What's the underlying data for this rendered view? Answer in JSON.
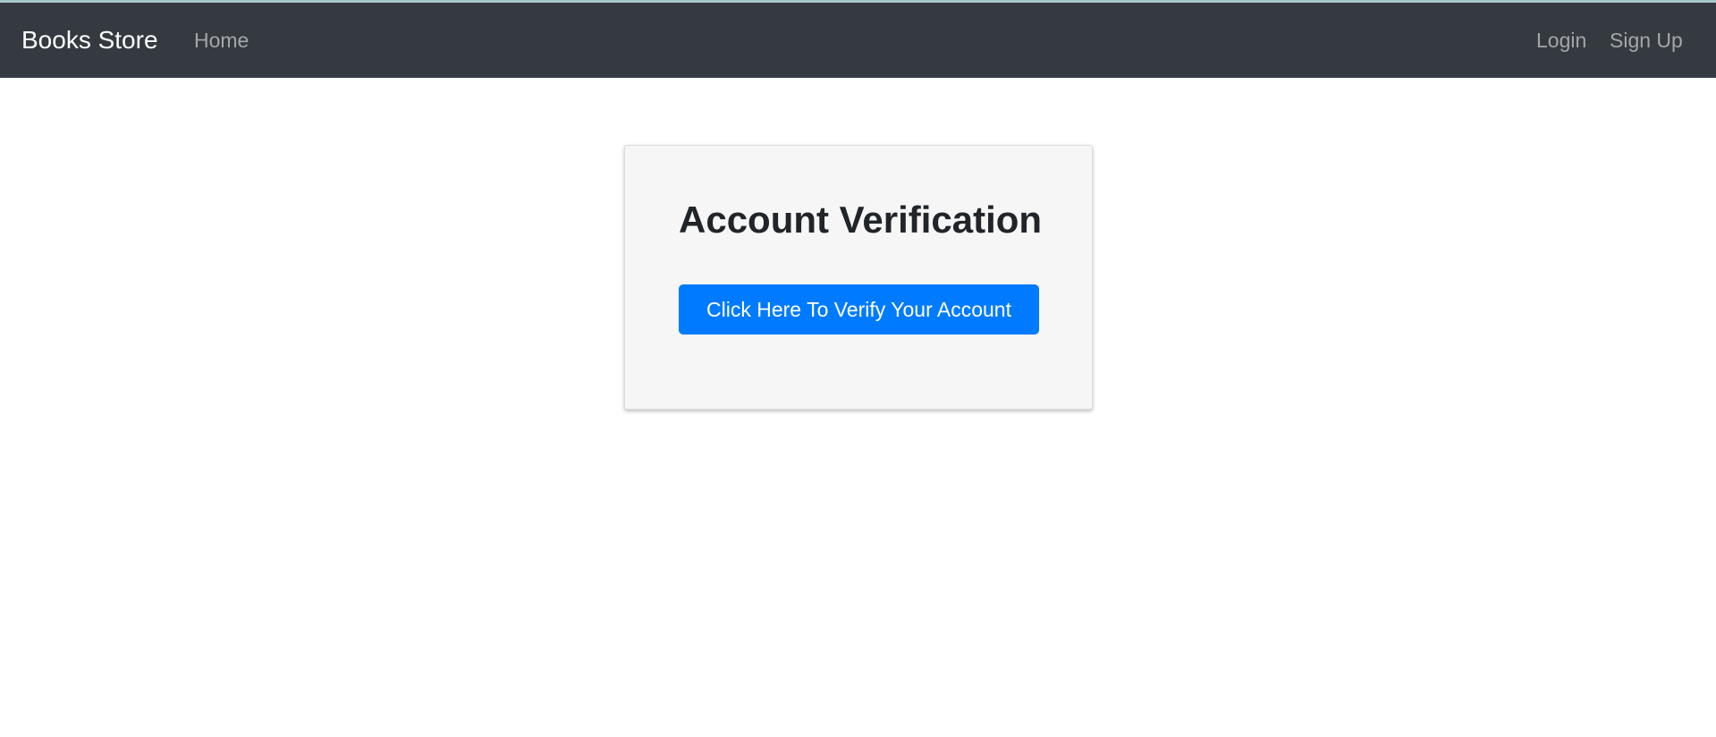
{
  "navbar": {
    "brand": "Books Store",
    "left_links": [
      {
        "label": "Home"
      }
    ],
    "right_links": [
      {
        "label": "Login"
      },
      {
        "label": "Sign Up"
      }
    ],
    "background_color": "#343a40"
  },
  "verification_card": {
    "title": "Account Verification",
    "button_label": "Click Here To Verify Your Account",
    "button_color": "#007bff"
  }
}
